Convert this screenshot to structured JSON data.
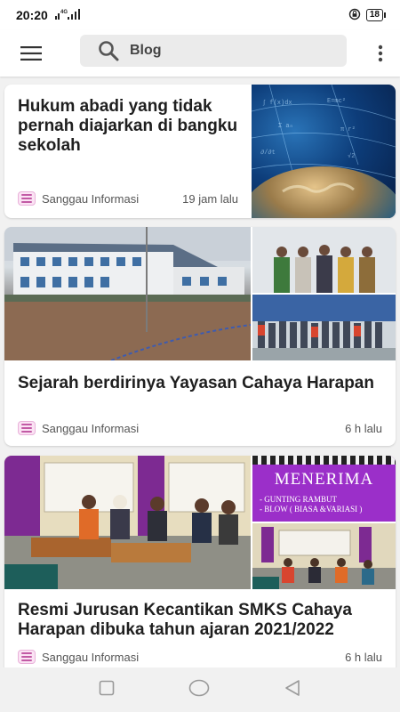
{
  "status_bar": {
    "time": "20:20",
    "network": "4G",
    "battery": "18"
  },
  "app_bar": {
    "search_text": "Blog"
  },
  "articles": [
    {
      "title": "Hukum abadi yang tidak pernah diajarkan di bangku sekolah",
      "source": "Sanggau Informasi",
      "time": "19 jam lalu"
    },
    {
      "title": "Sejarah berdirinya Yayasan Cahaya Harapan",
      "source": "Sanggau Informasi",
      "time": "6 h lalu"
    },
    {
      "title": "Resmi Jurusan Kecantikan SMKS Cahaya Harapan dibuka tahun ajaran 2021/2022",
      "source": "Sanggau Informasi",
      "time": "6 h lalu",
      "poster_headline": "MENERIMA",
      "poster_line_1": "- GUNTING RAMBUT",
      "poster_line_2": "- BLOW ( BIASA &VARIASI )"
    }
  ],
  "icons": {
    "menu": "hamburger-icon",
    "search": "search-icon",
    "more": "more-vert-icon",
    "source": "document-icon",
    "nav_recents": "square-icon",
    "nav_home": "circle-icon",
    "nav_back": "triangle-back-icon"
  },
  "colors": {
    "poster_purple": "#9b2fc9",
    "source_icon": "#c25aa5"
  }
}
